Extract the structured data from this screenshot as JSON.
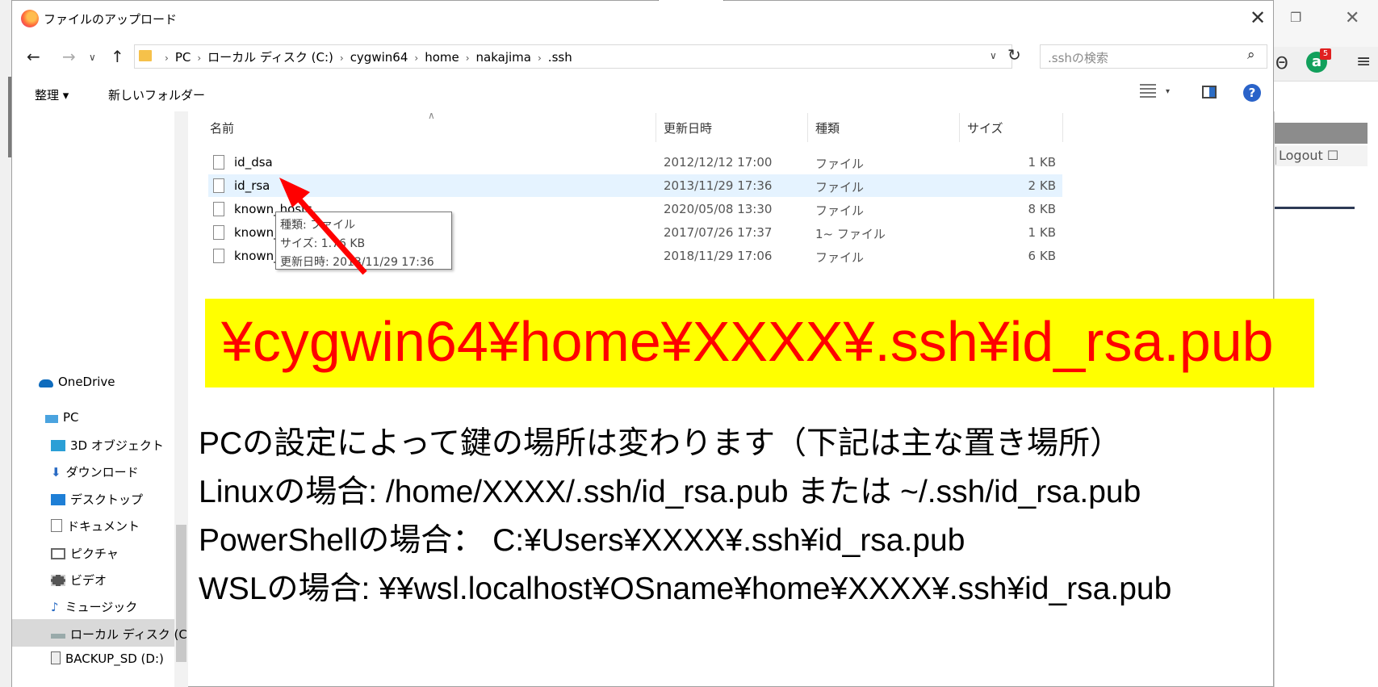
{
  "dialog": {
    "title": "ファイルのアップロード",
    "close_icon": "close-icon"
  },
  "address": {
    "crumbs": [
      "PC",
      "ローカル ディスク (C:)",
      "cygwin64",
      "home",
      "nakajima",
      ".ssh"
    ],
    "search_placeholder": ".sshの検索"
  },
  "toolbar": {
    "organize": "整理 ▾",
    "new_folder": "新しいフォルダー",
    "help": "?"
  },
  "columns": {
    "name": "名前",
    "date": "更新日時",
    "type": "種類",
    "size": "サイズ"
  },
  "files": [
    {
      "name": "id_dsa",
      "date": "2012/12/12 17:00",
      "type": "ファイル",
      "size": "1 KB"
    },
    {
      "name": "id_rsa",
      "date": "2013/11/29 17:36",
      "type": "ファイル",
      "size": "2 KB"
    },
    {
      "name": "known_hosts",
      "date": "2020/05/08 13:30",
      "type": "ファイル",
      "size": "8 KB"
    },
    {
      "name": "known_",
      "date": "2017/07/26 17:37",
      "type": "1~ ファイル",
      "size": "1 KB"
    },
    {
      "name": "known_",
      "date": "2018/11/29 17:06",
      "type": "ファイル",
      "size": "6 KB"
    }
  ],
  "tooltip": {
    "type": "種類: ファイル",
    "size": "サイズ: 1.76 KB",
    "date": "更新日時: 2013/11/29 17:36"
  },
  "nav": {
    "onedrive": "OneDrive",
    "pc": "PC",
    "objects3d": "3D オブジェクト",
    "downloads": "ダウンロード",
    "desktop": "デスクトップ",
    "documents": "ドキュメント",
    "pictures": "ピクチャ",
    "videos": "ビデオ",
    "music": "ミュージック",
    "local_disk": "ローカル ディスク (C",
    "backup": "BACKUP_SD (D:)"
  },
  "background_browser": {
    "logout": "Logout",
    "ext_badge": "5",
    "ext_letter": "a"
  },
  "overlay": {
    "banner": "¥cygwin64¥home¥XXXX¥.ssh¥id_rsa.pub",
    "banner_bg": "#ffff00",
    "banner_color": "#ff0000",
    "line1": "PCの設定によって鍵の場所は変わります（下記は主な置き場所）",
    "line2": "Linuxの場合: /home/XXXX/.ssh/id_rsa.pub または ~/.ssh/id_rsa.pub",
    "line3": "PowerShellの場合： C:¥Users¥XXXX¥.ssh¥id_rsa.pub",
    "line4": "WSLの場合: ¥¥wsl.localhost¥OSname¥home¥XXXX¥.ssh¥id_rsa.pub",
    "arrow_color": "#ff0000"
  }
}
